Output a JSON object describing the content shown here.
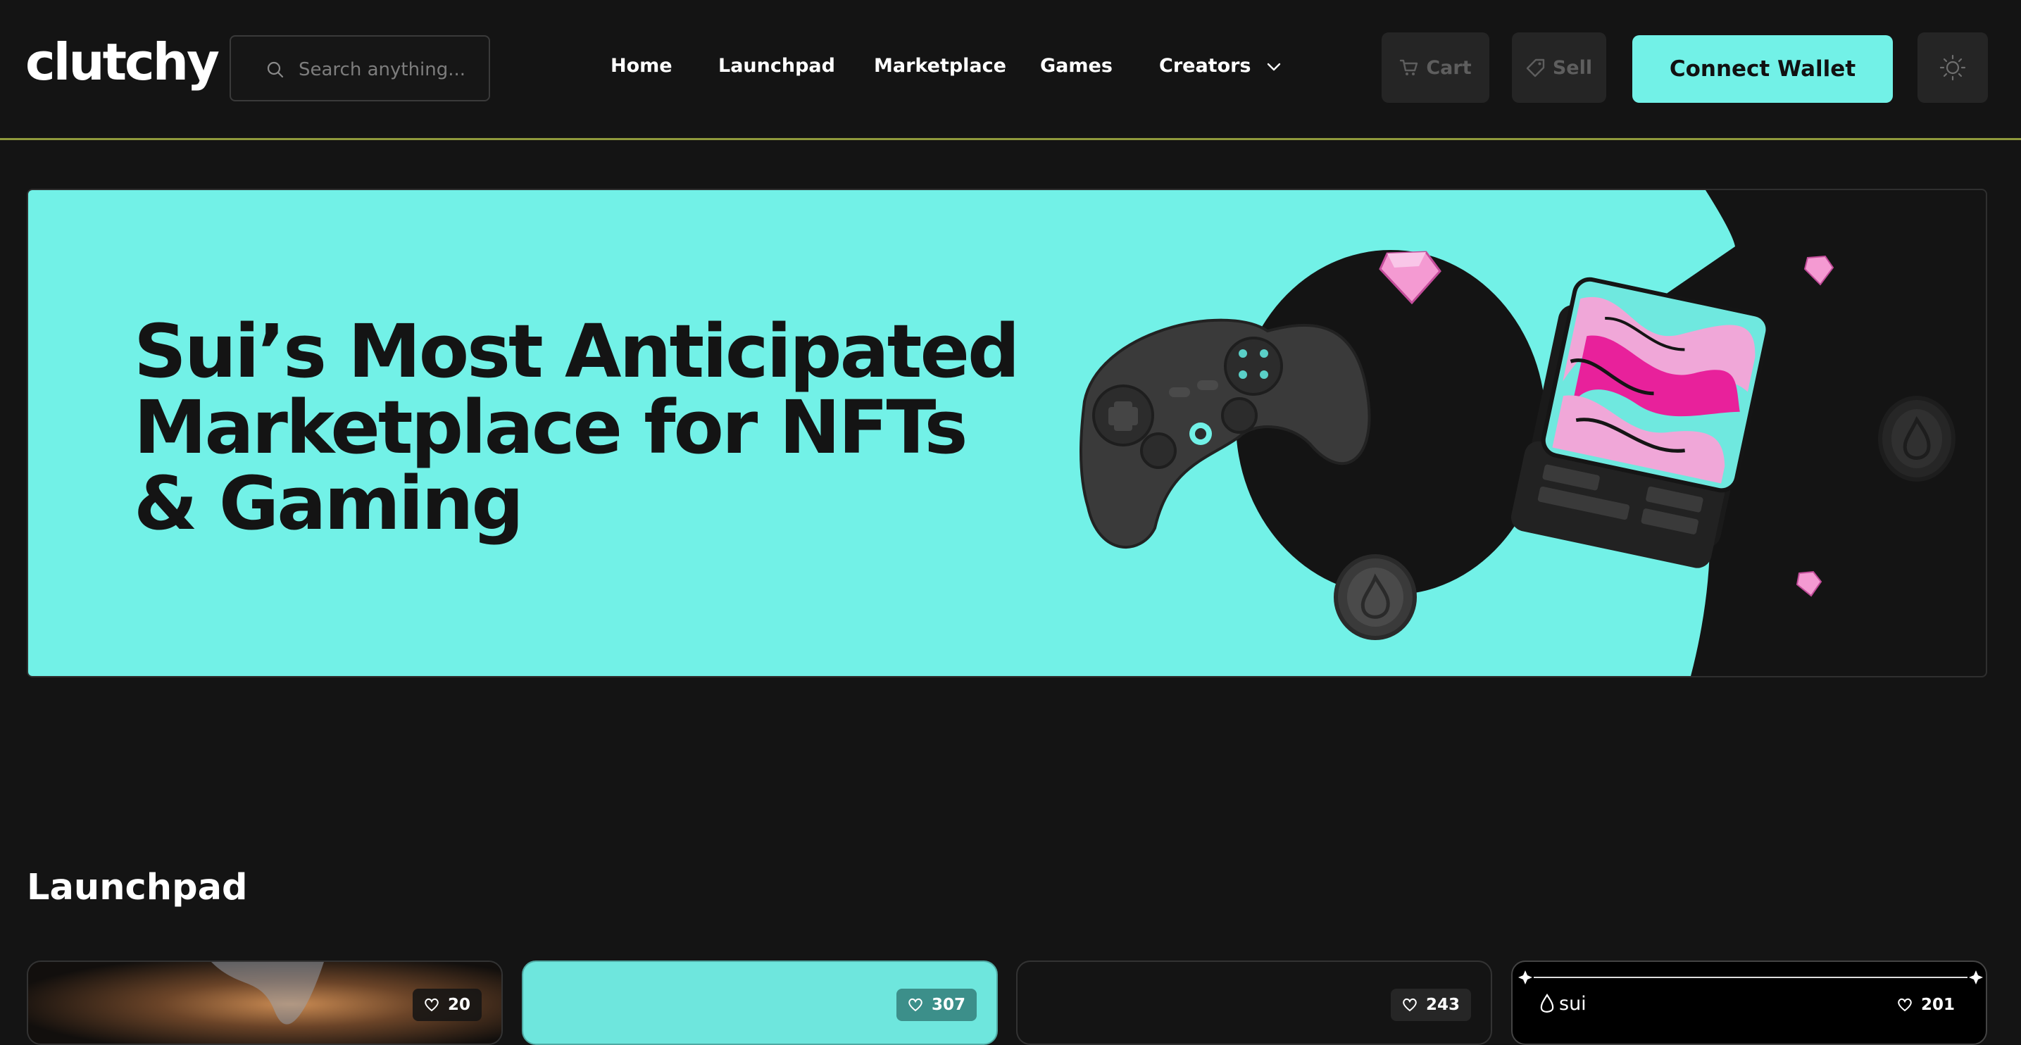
{
  "header": {
    "logo": "clutchy",
    "search_placeholder": "Search anything...",
    "nav": {
      "home": "Home",
      "launchpad": "Launchpad",
      "marketplace": "Marketplace",
      "games": "Games",
      "creators": "Creators"
    },
    "cart_label": "Cart",
    "sell_label": "Sell",
    "connect_wallet_label": "Connect Wallet",
    "icons": [
      "search-icon",
      "chevron-down-icon",
      "cart-icon",
      "tag-icon",
      "sun-icon"
    ]
  },
  "hero": {
    "title_line1": "Sui’s Most Anticipated",
    "title_line2": "Marketplace for NFTs",
    "title_line3": "& Gaming",
    "accent_color": "#72f1e7",
    "artwork": [
      "game-controller",
      "gems",
      "sui-coin",
      "nft-card"
    ]
  },
  "launchpad": {
    "title": "Launchpad",
    "cards": [
      {
        "likes": "20"
      },
      {
        "likes": "307"
      },
      {
        "likes": "243"
      },
      {
        "likes": "201",
        "brand": "sui"
      }
    ]
  },
  "colors": {
    "background": "#141414",
    "accent": "#72f1e7",
    "pink": "#f06bbf"
  }
}
